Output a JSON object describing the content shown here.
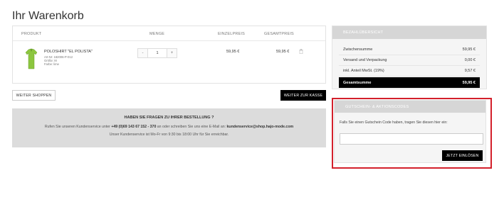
{
  "page": {
    "title": "Ihr Warenkorb"
  },
  "cart": {
    "headers": {
      "product": "PRODUKT",
      "quantity": "MENGE",
      "unit_price": "EINZELPREIS",
      "total_price": "GESAMTPREIS"
    },
    "items": [
      {
        "name": "POLOSHIRT \"EL POLISTA\"",
        "article": "Art-Nr: 182006-P-012",
        "size": "Größe: M",
        "color": "Farbe: lime",
        "quantity_minus": "-",
        "quantity": "1",
        "quantity_plus": "+",
        "unit_price": "59,95 €",
        "total_price": "59,95 €",
        "icon": "trash-icon",
        "product_color": "#8cc63f"
      }
    ]
  },
  "actions": {
    "continue_label": "WEITER SHOPPEN",
    "checkout_label": "WEITER ZUR KASSE"
  },
  "help": {
    "title": "HABEN SIE FRAGEN ZU IHRER BESTELLUNG ?",
    "line1_prefix": "Rufen Sie unseren Kundenservice unter ",
    "phone": "+49 (0)69 143 67 152 - 370",
    "line1_middle": " an oder schreiben Sie uns eine E-Mail an: ",
    "email": "kundenservice@shop.hajo-mode.com",
    "line2": "Unser Kundenservice ist Mo-Fr von 9:30 bis 18:00 Uhr für Sie erreichbar."
  },
  "summary": {
    "title": "BEZAHLÜBERSICHT",
    "rows": [
      {
        "label": "Zwischensumme",
        "value": "59,95 €"
      },
      {
        "label": "Versand und Verpackung",
        "value": "0,00 €"
      },
      {
        "label": "inkl. Anteil MwSt. (19%)",
        "value": "9,57 €"
      }
    ],
    "total": {
      "label": "Gesamtsumme",
      "value": "59,95 €"
    }
  },
  "coupon": {
    "title": "GUTSCHEIN- & AKTIONSCODES",
    "text": "Falls Sie einen Gutschein Code haben, tragen Sie diesen hier ein:",
    "input_value": "",
    "button_label": "JETZT EINLÖSEN",
    "highlight_color": "#d3202b"
  }
}
